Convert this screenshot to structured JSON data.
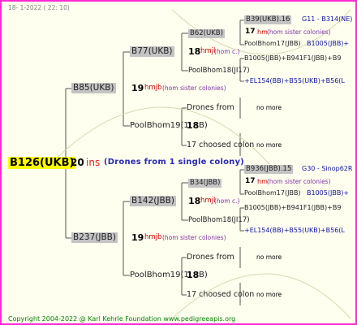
{
  "header": "18-  1-2022 ( 22: 10)",
  "footer": "Copyright 2004-2022 @ Karl Kehrle Foundation    www.pedigreeapis.org",
  "root": {
    "code": "B126(UKB)",
    "year": "20",
    "race": "ins",
    "note": "(Drones from 1 single colony)"
  },
  "mother_a": {
    "code": "B85(UKB)",
    "year": "19",
    "race": "hmjb",
    "race_note": "(hom sister colonies)",
    "mother": {
      "code": "B77(UKB)",
      "year": "18",
      "race": "hmjl",
      "race_note": "(hom c.)"
    },
    "father": {
      "code": "PoolBhom19(1",
      "year": "18",
      "tail": "B)"
    },
    "drones": "Drones from",
    "drones_note": "no more",
    "choosed": "17 choosed colon",
    "choosed_note": "no more"
  },
  "mother_b": {
    "code": "B237(JBB)",
    "year": "19",
    "race": "hmjb",
    "race_note": "(hom sister colonies)",
    "mother": {
      "code": "B142(JBB)",
      "year": "18",
      "race": "hmjl",
      "race_note": "(hom c.)"
    },
    "father": {
      "code": "PoolBhom19(1",
      "year": "18",
      "tail": "B)"
    },
    "drones": "Drones from",
    "drones_note": "no more",
    "choosed": "17 choosed colon",
    "choosed_note": "no more"
  },
  "gen4_top": {
    "gm_code": "B62(UKB)",
    "line1_code": "B39(UKB).16",
    "line1_info": "G11 - B314(NE)",
    "line2_year": "17",
    "line2_race": "hm",
    "line2_note": "(hom sister colonies)",
    "line3": "PoolBhom17(JBB)",
    "line3b": "B1005(JBB)+",
    "gf_code": "PoolBhom18(JI17)",
    "line4": "B1005(JBB)+B941F1(JBB)+B9",
    "line5": "+EL154(BB)+B55(UKB)+B56(L"
  },
  "gen4_bottom": {
    "gm_code": "B34(JBB)",
    "line1_code": "B936(JBB).15",
    "line1_info": "G30 - Sinop62R",
    "line2_year": "17",
    "line2_race": "hm",
    "line2_note": "(hom sister colonies)",
    "line3": "PoolBhom17(JBB)",
    "line3b": "B1005(JBB)+",
    "gf_code": "PoolBhom18(JI17)",
    "line4": "B1005(JBB)+B941F1(JBB)+B9",
    "line5": "+EL154(BB)+B55(UKB)+B56(L"
  }
}
